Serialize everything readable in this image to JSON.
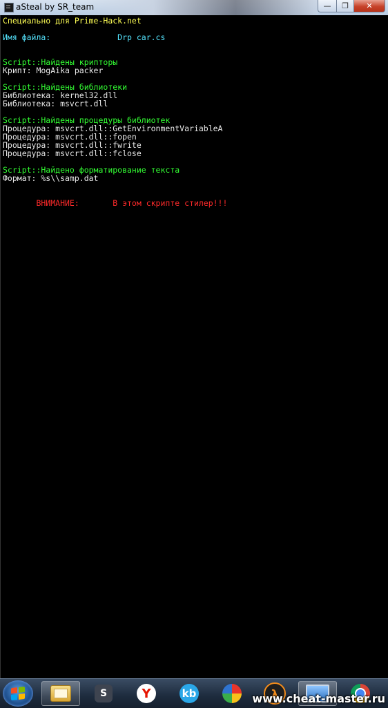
{
  "window": {
    "title": "aSteal by SR_team",
    "minimize_label": "—",
    "maximize_label": "❐",
    "close_label": "✕"
  },
  "console": {
    "lines": [
      {
        "text": "Специально для Prime-Hack.net",
        "color": "yellow"
      },
      {
        "text": "Имя файла:              Drp car.cs",
        "color": "cyan"
      },
      {
        "text": "Script::Найдены крипторы",
        "color": "green"
      },
      {
        "text": "Крипт: MogAika packer",
        "color": "white"
      },
      {
        "text": "Script::Найдены библиотеки",
        "color": "green"
      },
      {
        "text": "Библиотека: kernel32.dll",
        "color": "white"
      },
      {
        "text": "Библиотека: msvcrt.dll",
        "color": "white"
      },
      {
        "text": "Script::Найдены процедуры библиотек",
        "color": "green"
      },
      {
        "text": "Процедура: msvcrt.dll::GetEnvironmentVariableA",
        "color": "white"
      },
      {
        "text": "Процедура: msvcrt.dll::fopen",
        "color": "white"
      },
      {
        "text": "Процедура: msvcrt.dll::fwrite",
        "color": "white"
      },
      {
        "text": "Процедура: msvcrt.dll::fclose",
        "color": "white"
      },
      {
        "text": "Script::Найдено форматирование текста",
        "color": "green"
      },
      {
        "text": "Формат: %s\\\\samp.dat",
        "color": "white"
      },
      {
        "text": "       ВНИМАНИЕ:       В этом скрипте стилер!!!",
        "color": "red"
      }
    ]
  },
  "taskbar": {
    "items": [
      {
        "name": "start-button",
        "icon": "windows-flag-icon"
      },
      {
        "name": "explorer-taskbar-button",
        "icon": "folder-icon"
      },
      {
        "name": "steam-taskbar-button",
        "icon": "steam-icon",
        "glyph": "S"
      },
      {
        "name": "yandex-taskbar-button",
        "icon": "yandex-browser-icon",
        "glyph": "Y"
      },
      {
        "name": "kb-taskbar-button",
        "icon": "kb-icon",
        "glyph": "kb"
      },
      {
        "name": "picasa-taskbar-button",
        "icon": "picasa-icon"
      },
      {
        "name": "half-life-taskbar-button",
        "icon": "half-life-2-icon",
        "glyph": "λ"
      },
      {
        "name": "asteal-taskbar-button",
        "icon": "console-window-icon"
      },
      {
        "name": "chrome-taskbar-button",
        "icon": "chrome-icon"
      }
    ],
    "watermark": "www.cheat-master.ru"
  },
  "colors": {
    "yellow": "#ffff55",
    "cyan": "#55e5ff",
    "green": "#33ff33",
    "white": "#e8e8e8",
    "red": "#ff2a2a"
  }
}
